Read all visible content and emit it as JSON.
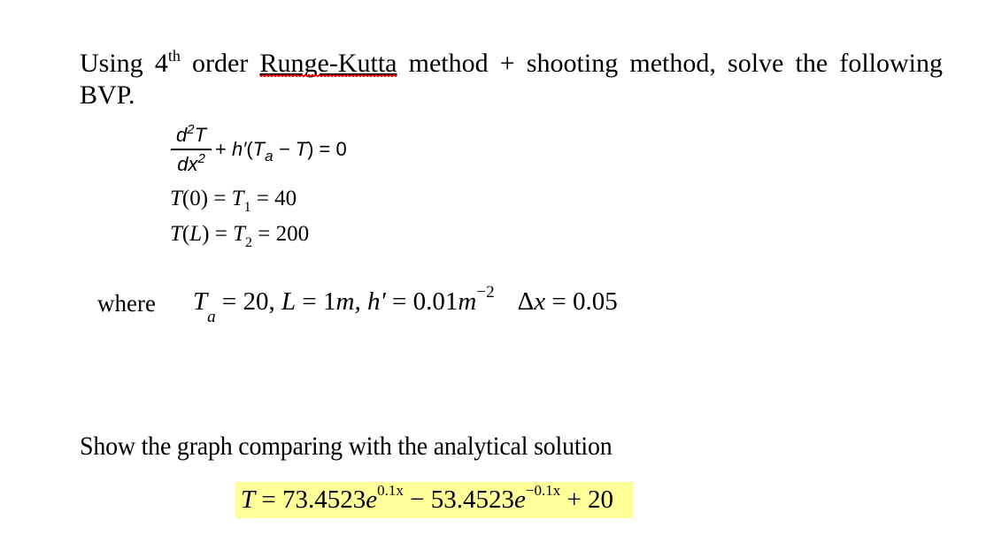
{
  "problem": {
    "intro_line1_before_sup": "Using 4",
    "intro_ordinal_suffix": "th",
    "intro_after_sup": " order ",
    "method_name": "Runge-Kutta",
    "intro_rest": " method + shooting method, solve the following",
    "intro_line2": "BVP.",
    "spellcheck_flagged_word": "Runge-Kutta"
  },
  "ode": {
    "numerator_d": "d",
    "numerator_power": "2",
    "numerator_var": "T",
    "denominator_dx": "dx",
    "denominator_power": "2",
    "term_plus": "+ ",
    "h_prime": "h′",
    "open_paren": "(",
    "T_a_base": "T",
    "T_a_sub": "a",
    "minus_T": " − T",
    "close_eq": ") = 0"
  },
  "boundary_conditions": [
    {
      "lhs_fn": "T",
      "lhs_arg": "(0)",
      "eq": " = ",
      "sym": "T",
      "sym_sub": "1",
      "rhs": " = 40"
    },
    {
      "lhs_fn": "T",
      "lhs_arg_open": "(",
      "lhs_arg_var": "L",
      "lhs_arg_close": ")",
      "eq": " = ",
      "sym": "T",
      "sym_sub": "2",
      "rhs": " = 200"
    }
  ],
  "parameters": {
    "where_label": "where",
    "Ta_base": "T",
    "Ta_sub": "a",
    "Ta_value": " = 20, ",
    "L_sym": "L",
    "L_value": " = 1",
    "L_unit": "m",
    "h_sym": ", h′",
    "h_value": " = 0.01",
    "h_unit": "m",
    "h_unit_exp": "−2",
    "dx_sym": "Δ",
    "dx_var": "x",
    "dx_value": " = 0.05"
  },
  "task": {
    "show_text": "Show the graph comparing with the analytical solution"
  },
  "analytical_solution": {
    "lhs": "T",
    "eq": " = 73.4523",
    "e1": "e",
    "exp1": "0.1x",
    "mid": " − 53.4523",
    "e2": "e",
    "exp2": "−0.1x",
    "tail": " + 20",
    "highlight_color": "#ffff99"
  }
}
